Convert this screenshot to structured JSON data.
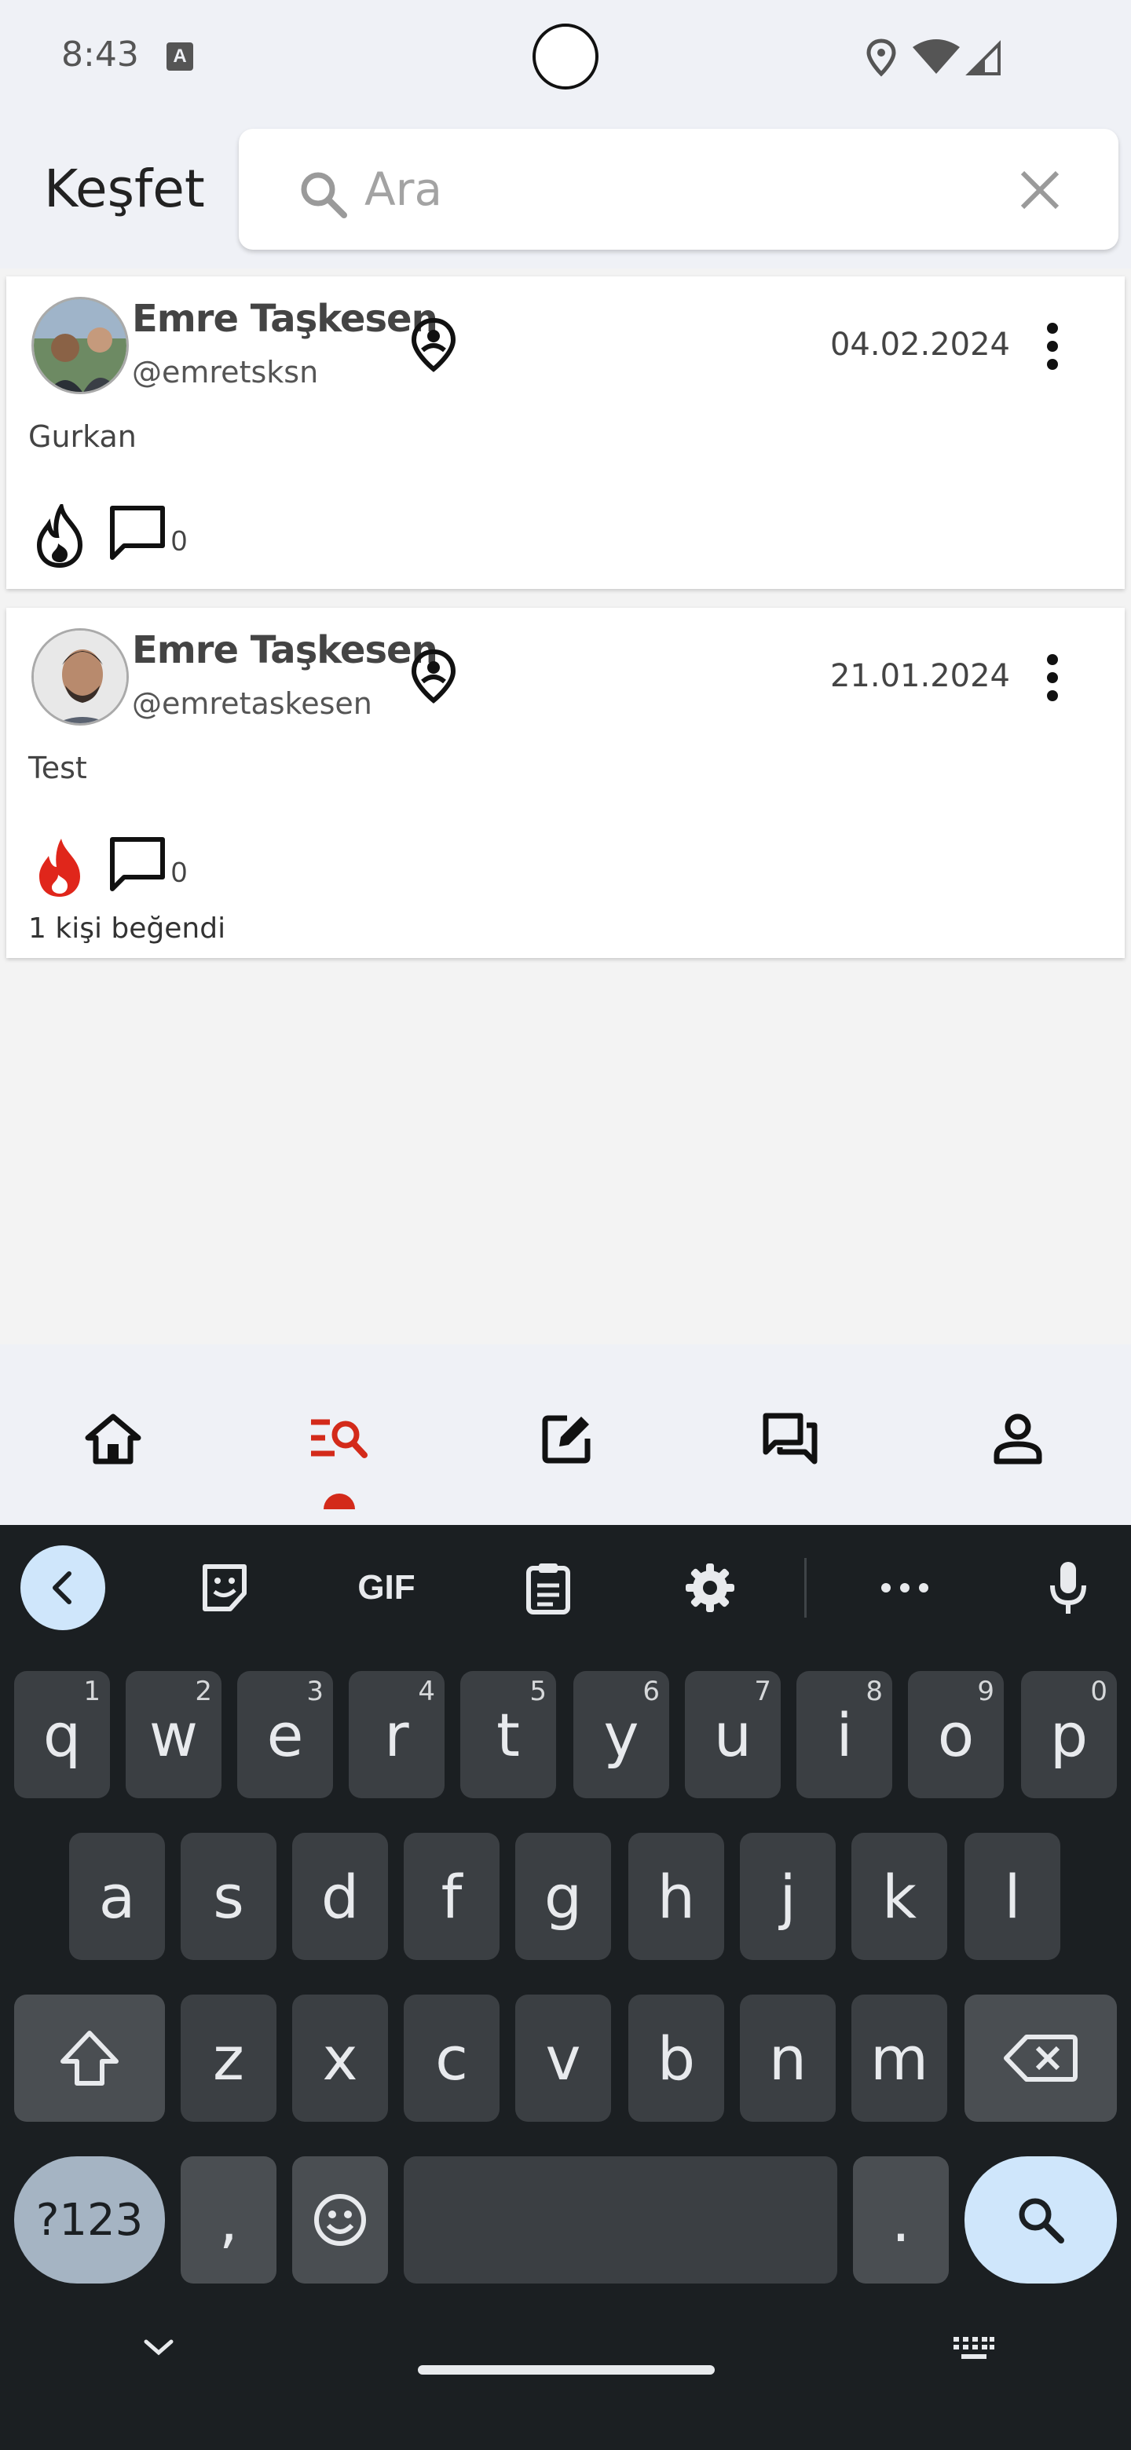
{
  "status_bar": {
    "time": "8:43",
    "a_icon": "A"
  },
  "header": {
    "title": "Keşfet",
    "search_placeholder": "Ara"
  },
  "posts": [
    {
      "name": "Emre Taşkesen",
      "handle": "@emretsksn",
      "date": "04.02.2024",
      "text": "Gurkan",
      "comment_count": "0",
      "liked": false,
      "likes_text": ""
    },
    {
      "name": "Emre Taşkesen",
      "handle": "@emretaskesen",
      "date": "21.01.2024",
      "text": "Test",
      "comment_count": "0",
      "liked": true,
      "likes_text": "1 kişi beğendi"
    }
  ],
  "nav": {
    "items": [
      "home-icon",
      "explore-icon",
      "edit-icon",
      "messages-icon",
      "profile-icon"
    ],
    "active": 1,
    "accent": "#d32a1a"
  },
  "keyboard": {
    "toolbar": {
      "gif": "GIF"
    },
    "row1": [
      {
        "k": "q",
        "h": "1"
      },
      {
        "k": "w",
        "h": "2"
      },
      {
        "k": "e",
        "h": "3"
      },
      {
        "k": "r",
        "h": "4"
      },
      {
        "k": "t",
        "h": "5"
      },
      {
        "k": "y",
        "h": "6"
      },
      {
        "k": "u",
        "h": "7"
      },
      {
        "k": "i",
        "h": "8"
      },
      {
        "k": "o",
        "h": "9"
      },
      {
        "k": "p",
        "h": "0"
      }
    ],
    "row2": [
      "a",
      "s",
      "d",
      "f",
      "g",
      "h",
      "j",
      "k",
      "l"
    ],
    "row3": [
      "z",
      "x",
      "c",
      "v",
      "b",
      "n",
      "m"
    ],
    "symbols": "?123",
    "comma": ",",
    "period": "."
  }
}
